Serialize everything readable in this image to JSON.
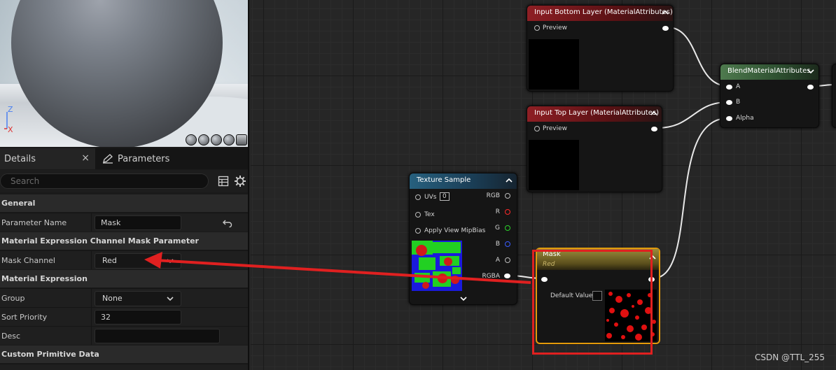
{
  "viewport": {
    "axis_z": "Z",
    "axis_x": "X"
  },
  "tabs": {
    "details": "Details",
    "close": "×",
    "parameters": "Parameters"
  },
  "search": {
    "placeholder": "Search"
  },
  "details": {
    "sections": {
      "general": "General",
      "channel_mask": "Material Expression Channel Mask Parameter",
      "material_expression": "Material Expression",
      "custom_primitive": "Custom Primitive Data"
    },
    "parameter_name": {
      "label": "Parameter Name",
      "value": "Mask"
    },
    "mask_channel": {
      "label": "Mask Channel",
      "value": "Red"
    },
    "group": {
      "label": "Group",
      "value": "None"
    },
    "sort_priority": {
      "label": "Sort Priority",
      "value": "32"
    },
    "desc": {
      "label": "Desc",
      "value": ""
    }
  },
  "graph": {
    "input_bottom": {
      "title": "Input Bottom Layer (MaterialAttributes)",
      "pin": "Preview"
    },
    "input_top": {
      "title": "Input Top Layer (MaterialAttributes)",
      "pin": "Preview"
    },
    "blend": {
      "title": "BlendMaterialAttributes",
      "pins": [
        "A",
        "B",
        "Alpha"
      ]
    },
    "texture_sample": {
      "title": "Texture Sample",
      "inputs": {
        "uvs": "UVs",
        "uvs_value": "0",
        "tex": "Tex",
        "mipbias": "Apply View MipBias"
      },
      "outputs": [
        "RGB",
        "R",
        "G",
        "B",
        "A",
        "RGBA"
      ],
      "output_colors": [
        "#dddddd",
        "#ff2a2a",
        "#2bd22b",
        "#3a5cff",
        "#dddddd",
        "#ffffff"
      ]
    },
    "mask": {
      "title": "Mask",
      "subtitle": "Red",
      "default_label": "Default Value"
    }
  },
  "colors": {
    "annotation_red": "#e02020",
    "selection_orange": "#e39a0a",
    "header_red": "#8e1f24",
    "header_green": "#4e7a4e",
    "header_blue": "#27607e"
  },
  "watermark": "CSDN @TTL_255"
}
